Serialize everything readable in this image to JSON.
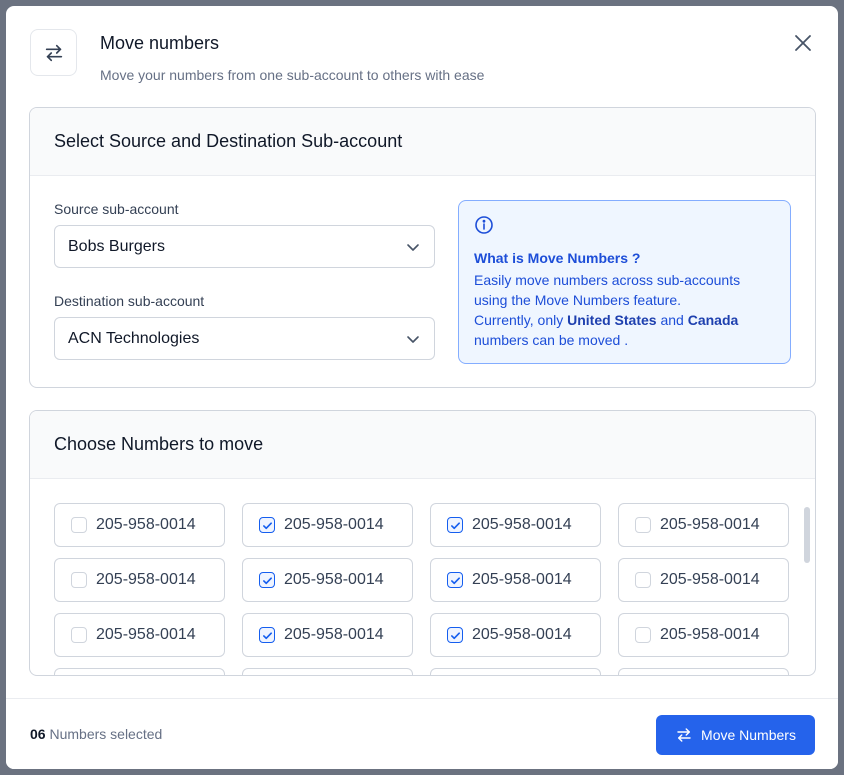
{
  "header": {
    "title": "Move numbers",
    "subtitle": "Move your numbers from one sub-account to others with ease",
    "icon": "swap-arrows-icon"
  },
  "source_card": {
    "title": "Select Source and Destination Sub-account",
    "source_label": "Source sub-account",
    "source_value": "Bobs Burgers",
    "destination_label": "Destination sub-account",
    "destination_value": "ACN Technologies"
  },
  "info": {
    "title": "What is Move Numbers ?",
    "line1": "Easily move numbers across sub-accounts",
    "line2": "using the Move Numbers feature.",
    "line3_prefix": "Currently, only ",
    "country1": "United States",
    "line3_mid": " and ",
    "country2": "Canada",
    "line4": "numbers can be moved ."
  },
  "numbers_card": {
    "title": "Choose Numbers to move",
    "numbers": [
      {
        "number": "205-958-0014",
        "checked": false
      },
      {
        "number": "205-958-0014",
        "checked": true
      },
      {
        "number": "205-958-0014",
        "checked": true
      },
      {
        "number": "205-958-0014",
        "checked": false
      },
      {
        "number": "205-958-0014",
        "checked": false
      },
      {
        "number": "205-958-0014",
        "checked": true
      },
      {
        "number": "205-958-0014",
        "checked": true
      },
      {
        "number": "205-958-0014",
        "checked": false
      },
      {
        "number": "205-958-0014",
        "checked": false
      },
      {
        "number": "205-958-0014",
        "checked": true
      },
      {
        "number": "205-958-0014",
        "checked": true
      },
      {
        "number": "205-958-0014",
        "checked": false
      },
      {
        "number": "",
        "checked": false
      },
      {
        "number": "",
        "checked": false
      },
      {
        "number": "",
        "checked": false
      },
      {
        "number": "",
        "checked": false
      }
    ]
  },
  "footer": {
    "selected_count": "06",
    "selected_label": "Numbers selected",
    "button_label": "Move Numbers"
  },
  "colors": {
    "primary": "#2563eb",
    "info_bg": "#eff6ff",
    "info_border": "#84adff"
  }
}
